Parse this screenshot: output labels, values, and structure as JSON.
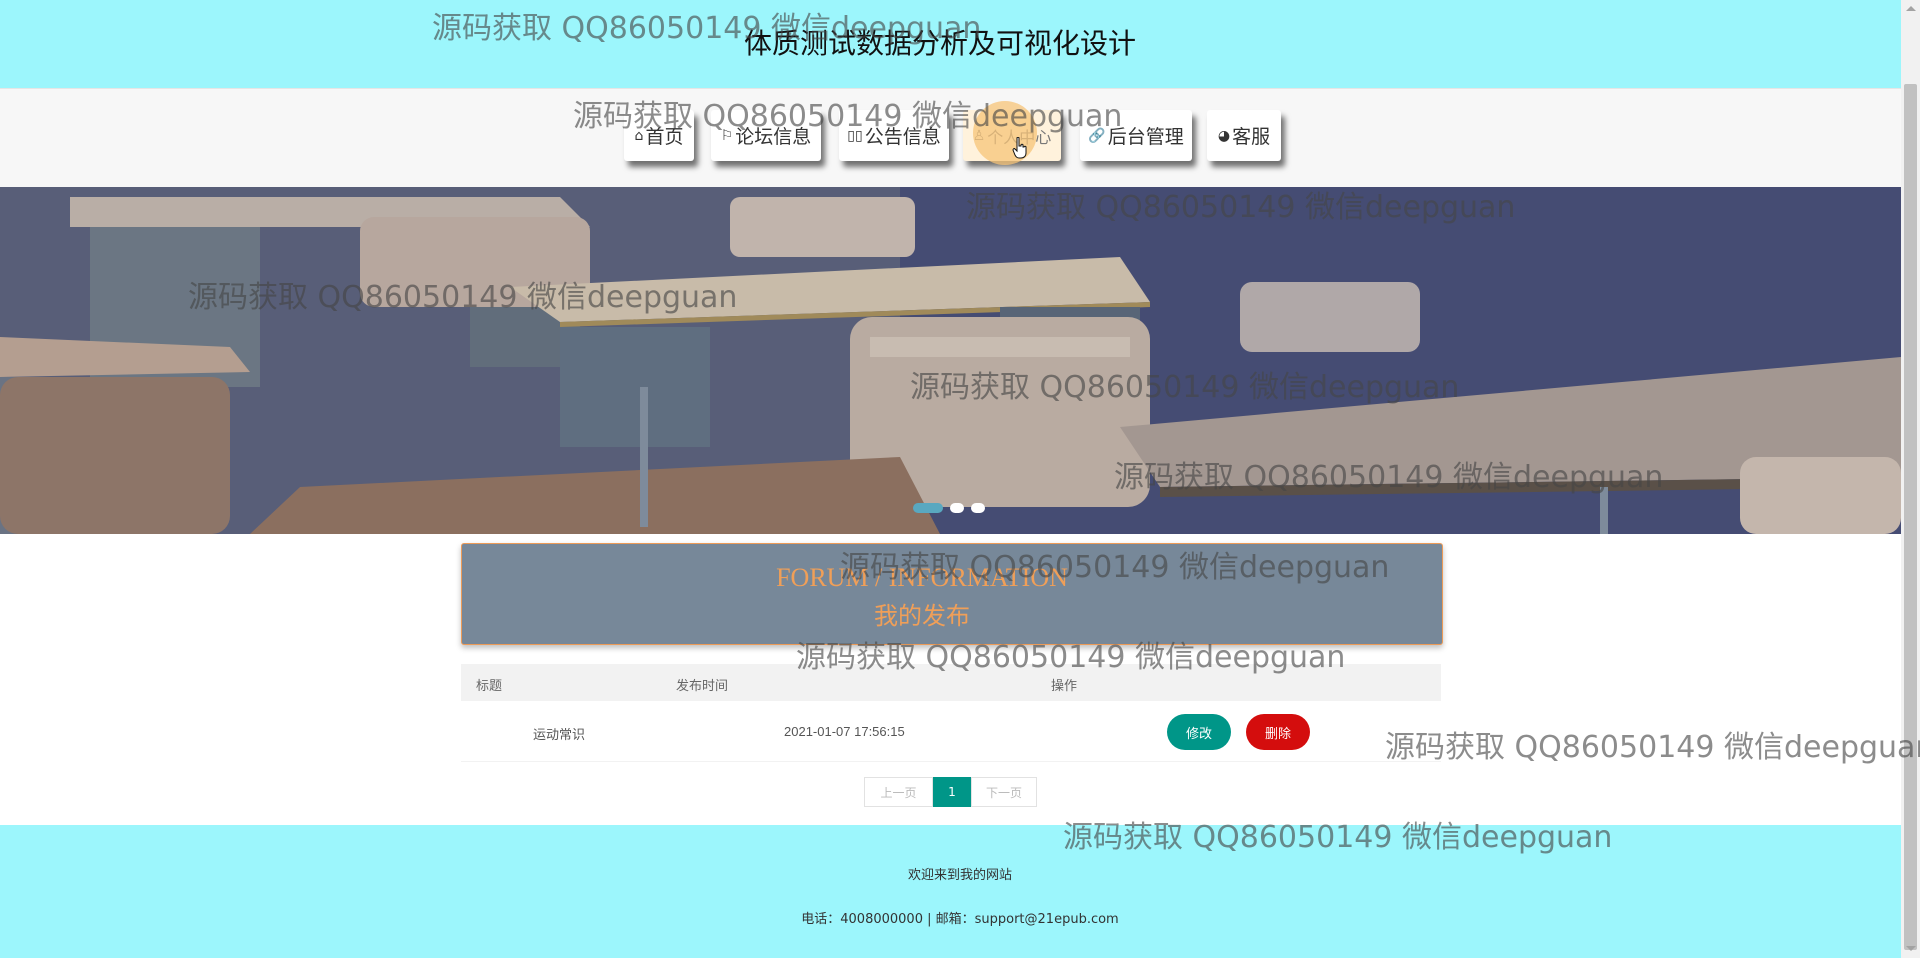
{
  "header": {
    "title": "体质测试数据分析及可视化设计"
  },
  "nav": [
    {
      "icon": "home-icon",
      "glyph": "⌂",
      "label": "首页"
    },
    {
      "icon": "flag-icon",
      "glyph": "⚐",
      "label": "论坛信息"
    },
    {
      "icon": "megaphone-icon",
      "glyph": "▯▯",
      "label": "公告信息"
    },
    {
      "icon": "user-icon",
      "glyph": "♙",
      "label": "个人中心"
    },
    {
      "icon": "link-icon",
      "glyph": "🔗",
      "label": "后台管理"
    },
    {
      "icon": "service-icon",
      "glyph": "◕",
      "label": "客服"
    }
  ],
  "carousel": {
    "slide_count": 3,
    "active_index": 0
  },
  "section": {
    "title_en": "FORUM / INFORMATION",
    "title_cn": "我的发布"
  },
  "table": {
    "columns": [
      "标题",
      "发布时间",
      "操作"
    ],
    "rows": [
      {
        "title": "运动常识",
        "time": "2021-01-07 17:56:15",
        "edit": "修改",
        "delete": "删除"
      }
    ]
  },
  "pagination": {
    "prev": "上一页",
    "current": "1",
    "next": "下一页"
  },
  "footer": {
    "welcome": "欢迎来到我的网站",
    "contact": "电话：4008000000 | 邮箱：support@21epub.com"
  },
  "watermark": "源码获取 QQ86050149 微信deepguan",
  "colors": {
    "header_bg": "#9cf6fc",
    "accent": "#009688",
    "danger": "#d40d0d",
    "forum_bg": "#778899",
    "forum_text": "#f09f58"
  }
}
